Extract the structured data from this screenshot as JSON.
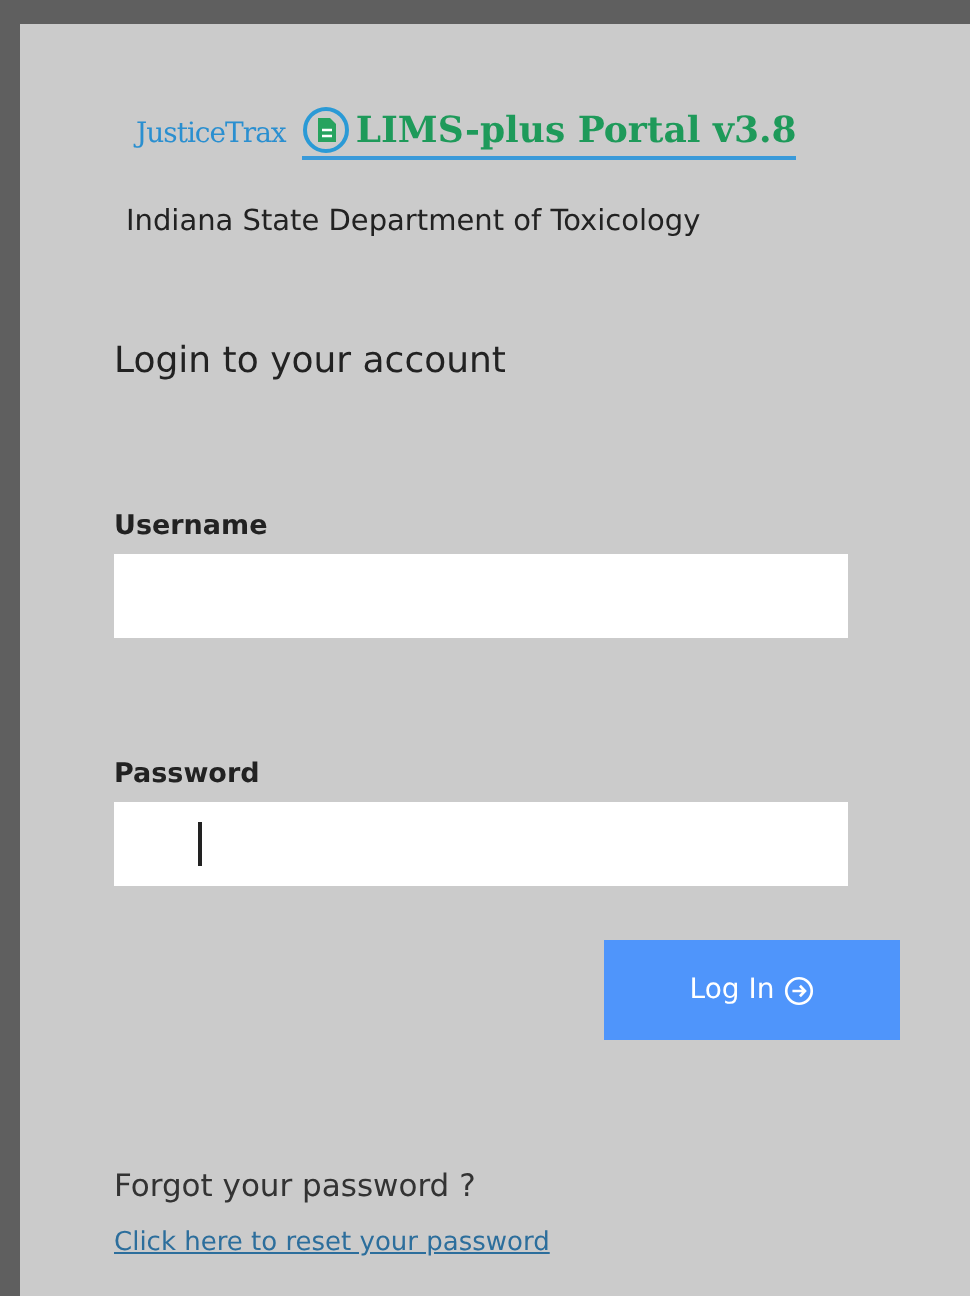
{
  "brand": {
    "logo_text": "JusticeTrax",
    "portal_title": "LIMS-plus Portal v3.8",
    "organization": "Indiana State Department of Toxicology"
  },
  "form": {
    "heading": "Login to your account",
    "fields": [
      {
        "label": "Username",
        "focused": false
      },
      {
        "label": "Password",
        "focused": true
      }
    ],
    "submit": {
      "label": "Log In"
    }
  },
  "forgot": {
    "question": "Forgot your password ?",
    "link": "Click here to reset your password"
  }
}
